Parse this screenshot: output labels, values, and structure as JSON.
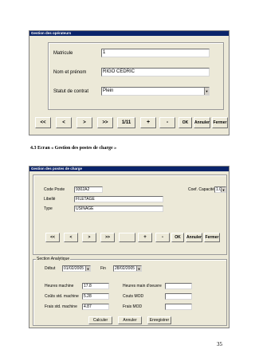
{
  "window1": {
    "title": "Gestion des opérateurs",
    "labels": {
      "matricule": "Matricule",
      "nom_prenom": "Nom et prénom",
      "statut": "Statut de contrat"
    },
    "values": {
      "matricule": "1",
      "nom_prenom": "RIGO CEDRIC",
      "statut": "Plein"
    },
    "nav": {
      "first": "<<",
      "prev": "<",
      "next": ">",
      "last": ">>",
      "record": "1/11"
    },
    "actions": {
      "add": "+",
      "remove": "-",
      "ok": "OK",
      "annuler": "Annuler",
      "fermer": "Fermer"
    }
  },
  "caption": "4.3  Ecran « Gestion des postes de charge »",
  "window2": {
    "title": "Gestion des postes de charge",
    "labels": {
      "code_poste": "Code Poste",
      "libelle": "Libellé",
      "type": "Type",
      "coef": "Coef. Capacité"
    },
    "values": {
      "code_poste": "9302A2",
      "libelle": "FILETAGE",
      "type": "USINAGE",
      "coef": "1.0"
    },
    "nav": {
      "first": "<<",
      "prev": "<",
      "next": ">",
      "last": ">>",
      "record": ""
    },
    "actions": {
      "add": "+",
      "remove": "-",
      "ok": "OK",
      "annuler": "Annuler",
      "fermer": "Fermer"
    },
    "section": {
      "title": "Section Analytique",
      "debut_label": "Début",
      "debut_value": "01/02/2005",
      "fin_label": "Fin",
      "fin_value": "28/02/2005",
      "heures_machine_label": "Heures machine",
      "heures_machine_value": "17.8",
      "couts_machine_label": "Coûts std. machine",
      "couts_machine_value": "5.28",
      "frais_machine_label": "Frais std. machine",
      "frais_machine_value": "4.87",
      "heures_mo_label": "Heures main d'oeuvre",
      "heures_mo_value": "",
      "couts_mod_label": "Couts MOD",
      "couts_mod_value": "",
      "frais_mod_label": "Frais MOD",
      "frais_mod_value": "",
      "calculer": "Calculer",
      "annuler": "Annuler",
      "enregistrer": "Enregistrer"
    }
  },
  "page_number": "35"
}
